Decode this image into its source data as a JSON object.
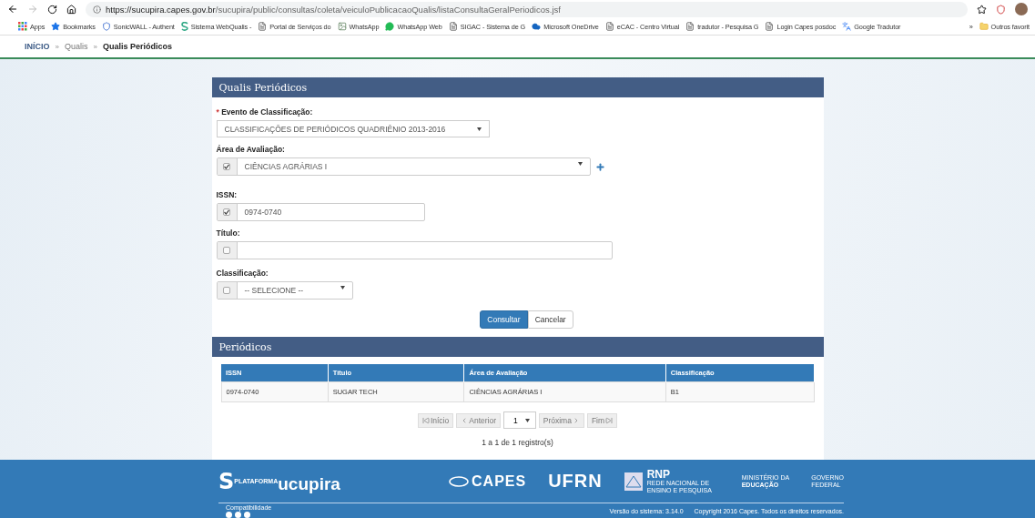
{
  "browser": {
    "url_host": "https://sucupira.capes.gov.br",
    "url_path": "/sucupira/public/consultas/coleta/veiculoPublicacaoQualis/listaConsultaGeralPeriodicos.jsf",
    "bookmarks": [
      {
        "label": "Apps",
        "kind": "apps"
      },
      {
        "label": "Bookmarks",
        "kind": "star"
      },
      {
        "label": "SonicWALL - Authent",
        "kind": "shield"
      },
      {
        "label": "Sistema WebQualis -",
        "kind": "s"
      },
      {
        "label": "Portal de Serviços do",
        "kind": "page"
      },
      {
        "label": "WhatsApp",
        "kind": "image"
      },
      {
        "label": "WhatsApp Web",
        "kind": "whatsapp"
      },
      {
        "label": "SIGAC - Sistema de G",
        "kind": "page"
      },
      {
        "label": "Microsoft OneDrive",
        "kind": "cloud"
      },
      {
        "label": "eCAC - Centro Virtual",
        "kind": "page"
      },
      {
        "label": "tradutor - Pesquisa G",
        "kind": "page"
      },
      {
        "label": "Login Capes posdoc",
        "kind": "page"
      },
      {
        "label": "Google Tradutor",
        "kind": "translate"
      }
    ],
    "more": "»",
    "other_folder": "Outros favorit"
  },
  "breadcrumb": [
    {
      "label": "INÍCIO",
      "kind": "home"
    },
    {
      "label": "Qualis",
      "kind": "link"
    },
    {
      "label": "Qualis Periódicos",
      "kind": "current"
    }
  ],
  "breadcrumb_separator": "»",
  "form": {
    "title": "Qualis Periódicos",
    "evento": {
      "label": "Evento de Classificação:",
      "required_mark": "*",
      "value": "CLASSIFICAÇÕES DE PERIÓDICOS QUADRIÊNIO 2013-2016"
    },
    "area": {
      "label": "Área de Avaliação:",
      "checked": true,
      "value": "CIÊNCIAS AGRÁRIAS I"
    },
    "issn": {
      "label": "ISSN:",
      "checked": true,
      "value": "0974-0740"
    },
    "titulo": {
      "label": "Título:",
      "checked": false
    },
    "classificacao": {
      "label": "Classificação:",
      "checked": false,
      "value": "-- SELECIONE --"
    },
    "buttons": [
      {
        "label": "Consultar",
        "kind": "primary"
      },
      {
        "label": "Cancelar",
        "kind": "default"
      }
    ]
  },
  "results": {
    "title": "Periódicos",
    "columns": [
      "ISSN",
      "Título",
      "Área de Avaliação",
      "Classificação"
    ],
    "rows": [
      [
        "0974-0740",
        "SUGAR TECH",
        "CIÊNCIAS AGRÁRIAS I",
        "B1"
      ]
    ],
    "pager": {
      "first": "Início",
      "prev": "Anterior",
      "page": "1",
      "next": "Próxima",
      "last": "Fim"
    },
    "summary": "1 a 1 de 1 registro(s)"
  },
  "footer": {
    "brand_initial": "S",
    "platform": "PLATAFORMA",
    "brand": "ucupira",
    "capes": "CAPES",
    "ufrn": "UFRN",
    "rnp": "RNP",
    "rnp_sub": "REDE NACIONAL DE ENSINO E PESQUISA",
    "mec_top": "MINISTÉRIO DA",
    "mec_bottom": "EDUCAÇÃO",
    "gov_top": "GOVERNO",
    "gov_bottom": "FEDERAL",
    "compat": "Compatibilidade",
    "version": "Versão do sistema: 3.14.0",
    "copyright": "Copyright 2016 Capes. Todos os direitos reservados."
  }
}
